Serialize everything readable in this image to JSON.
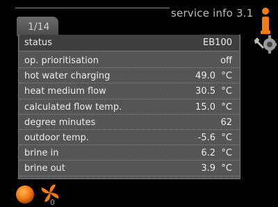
{
  "screen": {
    "title": "service info 3.1",
    "page_indicator": "1/14"
  },
  "header": {
    "label": "status",
    "value": "EB100"
  },
  "rows": [
    {
      "label": "op. prioritisation",
      "value": "off",
      "unit": ""
    },
    {
      "label": "hot water charging",
      "value": "49.0",
      "unit": "°C"
    },
    {
      "label": "heat medium flow",
      "value": "30.5",
      "unit": "°C"
    },
    {
      "label": "calculated flow temp.",
      "value": "15.0",
      "unit": "°C"
    },
    {
      "label": "degree minutes",
      "value": "62",
      "unit": ""
    },
    {
      "label": "outdoor temp.",
      "value": "-5.6",
      "unit": "°C"
    },
    {
      "label": "brine in",
      "value": "6.2",
      "unit": "°C"
    },
    {
      "label": "brine out",
      "value": "3.9",
      "unit": "°C"
    }
  ],
  "status_bar": {
    "fan_counter": "0"
  },
  "icons": {
    "info": "info-icon",
    "tools": "wrench-tools-icon",
    "orb": "status-orb-icon",
    "fan": "fan-icon"
  },
  "colors": {
    "accent_orange": "#f07c14",
    "panel_gray": "#555555",
    "header_gray": "#3f3f3f"
  }
}
